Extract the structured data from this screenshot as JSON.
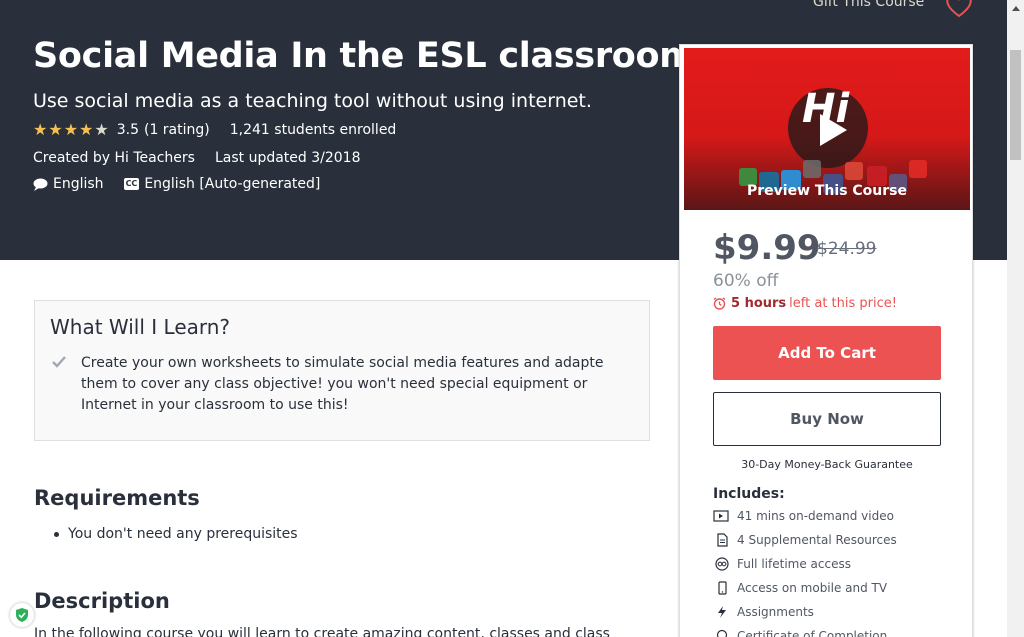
{
  "header": {
    "gift_label": "Gift This Course",
    "title": "Social Media In the ESL classroom",
    "subtitle": "Use social media as a teaching tool without using internet.",
    "rating_value": "3.5",
    "rating_count": "(1 rating)",
    "stars_filled": 4,
    "stars_total": 5,
    "enrolled": "1,241 students enrolled",
    "created_by": "Created by Hi Teachers",
    "last_updated": "Last updated 3/2018",
    "language": "English",
    "captions": "English [Auto-generated]"
  },
  "card": {
    "preview_label": "Preview This Course",
    "price": "$9.99",
    "original_price": "$24.99",
    "discount": "60% off",
    "timer_bold": "5 hours",
    "timer_rest": "left at this price!",
    "add_to_cart": "Add To Cart",
    "buy_now": "Buy Now",
    "guarantee": "30-Day Money-Back Guarantee",
    "includes_title": "Includes:",
    "includes": [
      {
        "icon": "video-icon",
        "text": "41 mins on-demand video"
      },
      {
        "icon": "file-icon",
        "text": "4 Supplemental Resources"
      },
      {
        "icon": "infinity-icon",
        "text": "Full lifetime access"
      },
      {
        "icon": "mobile-icon",
        "text": "Access on mobile and TV"
      },
      {
        "icon": "bolt-icon",
        "text": "Assignments"
      },
      {
        "icon": "certificate-icon",
        "text": "Certificate of Completion"
      }
    ]
  },
  "learn": {
    "title": "What Will I Learn?",
    "items": [
      "Create your own worksheets to simulate social media features and adapte them to cover any class objective! you won't need special equipment or Internet in your classroom to use this!"
    ]
  },
  "requirements": {
    "title": "Requirements",
    "items": [
      "You don't need any prerequisites"
    ]
  },
  "description": {
    "title": "Description",
    "text": "In the following course you will learn to create amazing content, classes and class"
  },
  "colors": {
    "header_bg": "#29303b",
    "accent_red": "#ec5252",
    "star": "#f4c150"
  }
}
